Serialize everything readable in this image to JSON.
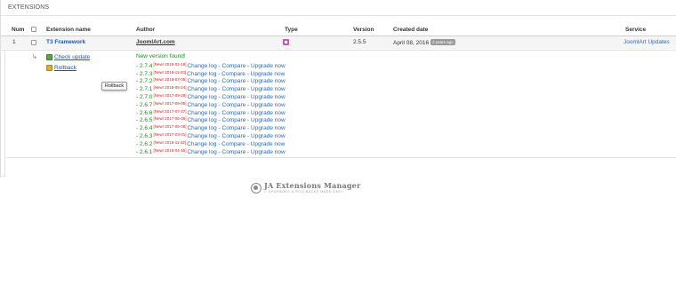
{
  "panel": {
    "title": "EXTENSIONS"
  },
  "table": {
    "headers": {
      "num": "Num",
      "name": "Extension name",
      "author": "Author",
      "type": "Type",
      "version": "Version",
      "created": "Created date",
      "service": "Service"
    },
    "row": {
      "num": "1",
      "name": "T3 Framework",
      "author": "JoomlArt.com",
      "type_icon": "plugin-icon",
      "version": "2.5.5",
      "created_date": "April 08, 2016",
      "created_ago": "2 years ago",
      "service": "JoomlArt Updates"
    }
  },
  "actions": {
    "check_update": "Check update",
    "rollback": "Rollback",
    "rollback_tooltip": "Rollback"
  },
  "updates": {
    "found_text": "New version found!",
    "items": [
      {
        "version": "- 2.7.4",
        "date": "[New! 2018-02-18]",
        "links": "Change log - Compare - Upgrade now"
      },
      {
        "version": "- 2.7.3",
        "date": "[New! 2018-11-23]",
        "links": "Change log - Compare - Upgrade now"
      },
      {
        "version": "- 2.7.2",
        "date": "[New! 2018-07-05]",
        "links": "Change log - Compare - Upgrade now"
      },
      {
        "version": "- 2.7.1",
        "date": "[New! 2018-05-24]",
        "links": "Change log - Compare - Upgrade now"
      },
      {
        "version": "- 2.7.0",
        "date": "[New! 2017-09-29]",
        "links": "Change log - Compare - Upgrade now"
      },
      {
        "version": "- 2.6.7",
        "date": "[New! 2017-09-05]",
        "links": "Change log - Compare - Upgrade now"
      },
      {
        "version": "- 2.6.6",
        "date": "[New! 2017-07-27]",
        "links": "Change log - Compare - Upgrade now"
      },
      {
        "version": "- 2.6.5",
        "date": "[New! 2017-06-26]",
        "links": "Change log - Compare - Upgrade now"
      },
      {
        "version": "- 2.6.4",
        "date": "[New! 2017-05-08]",
        "links": "Change log - Compare - Upgrade now"
      },
      {
        "version": "- 2.6.3",
        "date": "[New! 2017-03-01]",
        "links": "Change log - Compare - Upgrade now"
      },
      {
        "version": "- 2.6.2",
        "date": "[New! 2016-11-22]",
        "links": "Change log - Compare - Upgrade now"
      },
      {
        "version": "- 2.6.1",
        "date": "[New! 2016-04-15]",
        "links": "Change log - Compare - Upgrade now"
      }
    ]
  },
  "footer": {
    "logo_title": "JA Extensions Manager",
    "logo_subtitle": "// UPGRADES & ROLLBACKS MADE EASY"
  },
  "colors": {
    "link_blue": "#1e58a8",
    "new_version_green": "#1c8e1c",
    "date_red": "#d82020",
    "type_badge": "#c558c8"
  }
}
